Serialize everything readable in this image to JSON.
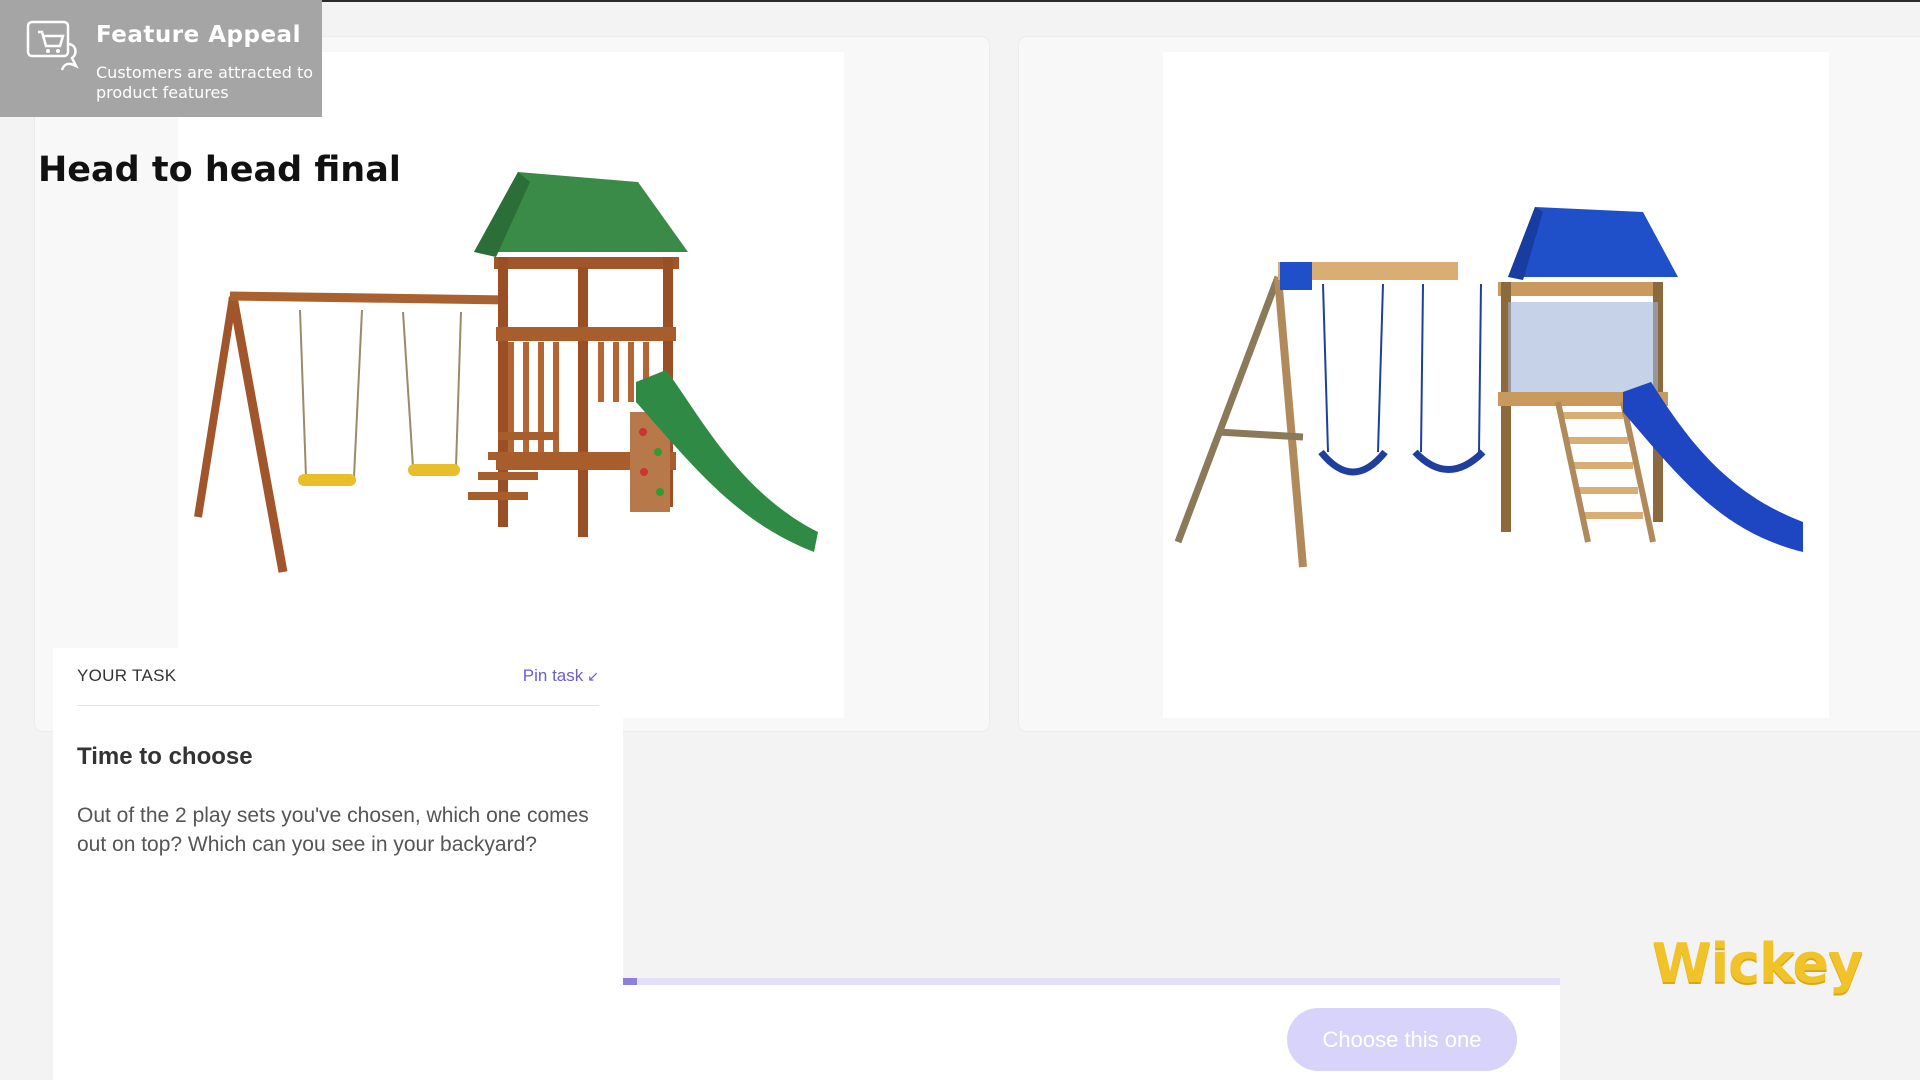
{
  "badge": {
    "title": "Feature Appeal",
    "subtitle": "Customers are attracted to product features",
    "icon": "cart-speech-icon"
  },
  "heading": "Head to head final",
  "products": [
    {
      "name": "green-canopy-playset",
      "canopy_color": "#3a8a48",
      "slide_color": "#2f8a45"
    },
    {
      "name": "blue-canopy-playset",
      "canopy_color": "#1f4fc9",
      "slide_color": "#1f46c2"
    }
  ],
  "task": {
    "label": "YOUR TASK",
    "pin_label": "Pin task",
    "pin_icon": "pin-collapse-icon",
    "title": "Time to choose",
    "body": "Out of the 2 play sets you've chosen, which one comes out on top? Which can you see in your backyard?"
  },
  "progress": {
    "fraction": 0.015
  },
  "choose_button": "Choose this one",
  "logo": "Wickey",
  "colors": {
    "accent": "#8b7fe0",
    "button_bg": "#d7d3fa",
    "logo": "#f2c229"
  }
}
